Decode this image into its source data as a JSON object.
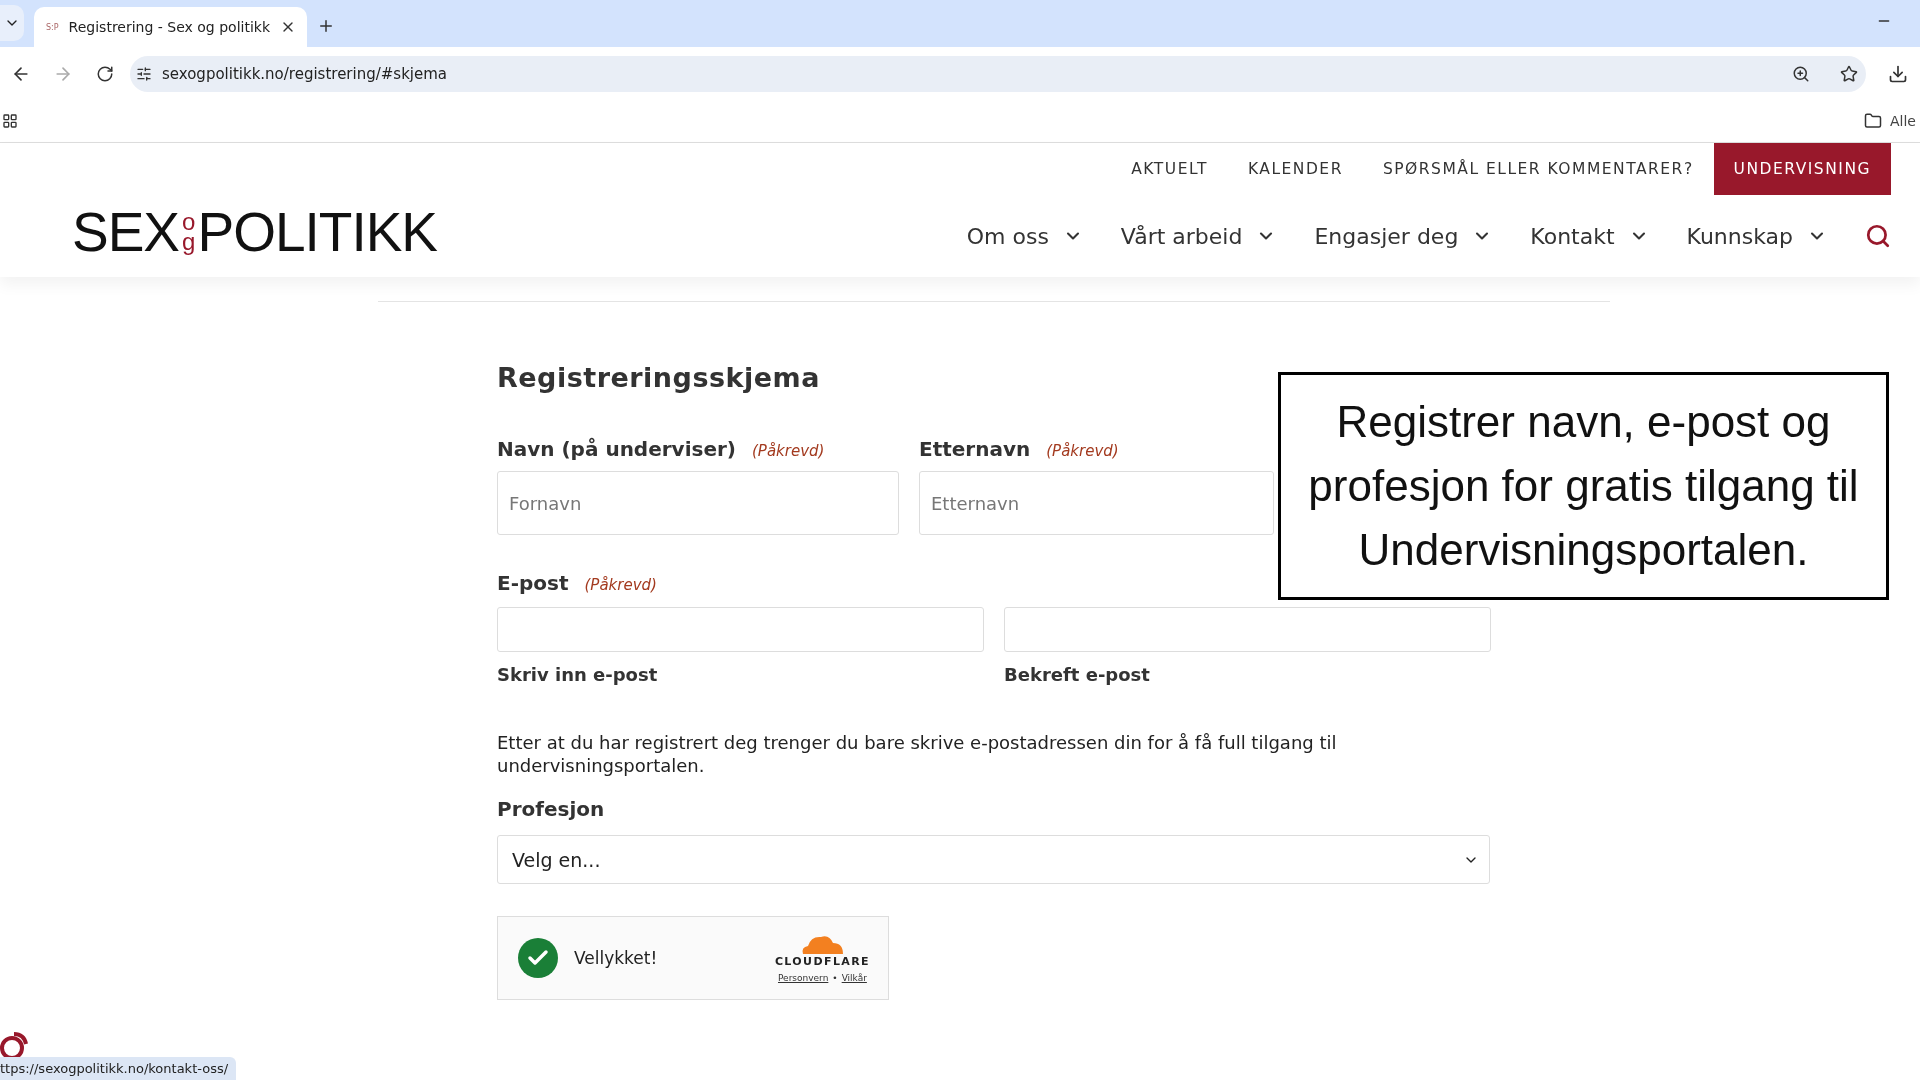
{
  "browser": {
    "tab": {
      "favicon": "S:P",
      "title": "Registrering - Sex og politikk",
      "selected": true
    },
    "address": "sexogpolitikk.no/registrering/#skjema",
    "bookmarks": [
      "Alle"
    ],
    "status_url": "ttps://sexogpolitikk.no/kontakt-oss/"
  },
  "top_links": [
    {
      "label": "AKTUELT",
      "highlighted": false
    },
    {
      "label": "KALENDER",
      "highlighted": false
    },
    {
      "label": "SPØRSMÅL ELLER KOMMENTARER?",
      "highlighted": false
    },
    {
      "label": "UNDERVISNING",
      "highlighted": true
    }
  ],
  "logo": {
    "left": "SEX",
    "middle": "og",
    "right": "POLITIKK"
  },
  "nav": [
    "Om oss",
    "Vårt arbeid",
    "Engasjer deg",
    "Kontakt",
    "Kunnskap"
  ],
  "form": {
    "title": "Registreringsskjema",
    "name_fields": [
      {
        "label": "Navn (på underviser)",
        "required": "(Påkrevd)",
        "placeholder": "Fornavn"
      },
      {
        "label": "Etternavn",
        "required": "(Påkrevd)",
        "placeholder": "Etternavn"
      }
    ],
    "email": {
      "label": "E-post",
      "required": "(Påkrevd)",
      "sublabels": [
        "Skriv inn e-post",
        "Bekreft e-post"
      ]
    },
    "info": "Etter at du har registrert deg trenger du bare skrive e-postadressen din for å få full tilgang til undervisningsportalen.",
    "profession": {
      "label": "Profesjon",
      "value": "Velg en..."
    },
    "captcha": {
      "status": "Vellykket!",
      "success": true,
      "brand": "CLOUDFLARE",
      "links": [
        "Personvern",
        "Vilkår"
      ],
      "separator": "•"
    }
  },
  "overlay_note": "Registrer navn, e-post og profesjon for gratis tilgang til Undervisningsportalen."
}
